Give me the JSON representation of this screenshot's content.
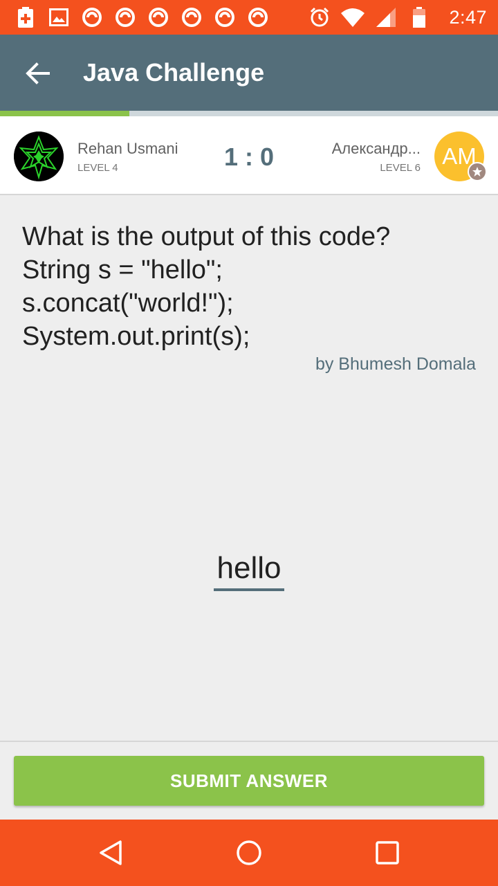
{
  "status_bar": {
    "time": "2:47",
    "left_icons": [
      "battery-plus-icon",
      "image-icon",
      "app-notification-icon",
      "app-notification-icon",
      "app-notification-icon",
      "app-notification-icon",
      "app-notification-icon",
      "app-notification-icon"
    ],
    "right_icons": [
      "alarm-icon",
      "wifi-icon",
      "signal-icon",
      "battery-icon"
    ]
  },
  "app_bar": {
    "title": "Java Challenge",
    "back_icon": "arrow-back-icon"
  },
  "progress": {
    "fraction": 0.26
  },
  "players": {
    "left": {
      "name": "Rehan Usmani",
      "level": "LEVEL 4"
    },
    "score": "1 : 0",
    "right": {
      "name": "Александр...",
      "level": "LEVEL 6",
      "initials": "AM"
    }
  },
  "question": {
    "text": "What is the output of this code?\nString s = \"hello\";\ns.concat(\"world!\");\nSystem.out.print(s);",
    "author": "by Bhumesh Domala"
  },
  "answer": {
    "value": "hello"
  },
  "submit": {
    "label": "SUBMIT ANSWER"
  },
  "colors": {
    "status_bar": "#f4511e",
    "app_bar": "#546e7a",
    "accent_green": "#8bc34a",
    "avatar_yellow": "#fbc02d"
  },
  "nav_icons": [
    "back-triangle-icon",
    "home-circle-icon",
    "recents-square-icon"
  ]
}
